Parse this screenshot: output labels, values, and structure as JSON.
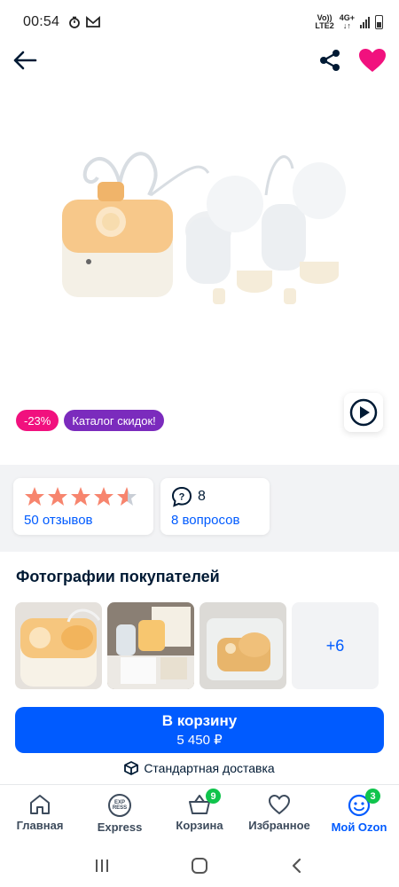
{
  "status_bar": {
    "time": "00:54",
    "network_top": "Vo))",
    "network_bottom": "LTE2",
    "network_type": "4G+"
  },
  "header": {
    "back_icon": "arrow-left-icon",
    "share_icon": "share-icon",
    "favorite_icon": "heart-icon",
    "favorite_color": "#f1117e"
  },
  "badges": {
    "discount": "-23%",
    "catalog": "Каталог скидок!"
  },
  "rating": {
    "stars": 4.5,
    "reviews_label": "50 отзывов",
    "questions_count": "8",
    "questions_label": "8 вопросов"
  },
  "photos": {
    "title": "Фотографии покупателей",
    "more_label": "+6"
  },
  "cart": {
    "label": "В корзину",
    "price": "5 450 ₽"
  },
  "delivery": {
    "label": "Стандартная доставка"
  },
  "bottom_nav": {
    "items": [
      {
        "label": "Главная",
        "icon": "home-icon"
      },
      {
        "label": "Express",
        "icon": "express-icon"
      },
      {
        "label": "Корзина",
        "icon": "basket-icon",
        "badge": "9"
      },
      {
        "label": "Избранное",
        "icon": "heart-outline-icon"
      },
      {
        "label": "Мой Ozon",
        "icon": "profile-face-icon",
        "badge": "3"
      }
    ],
    "express_icon_top": "EXP",
    "express_icon_bottom": "RESS"
  },
  "colors": {
    "accent": "#005bff",
    "discount": "#f1117e",
    "catalog": "#7b2bbd",
    "badge_green": "#10c44c",
    "star": "#f7856e"
  }
}
